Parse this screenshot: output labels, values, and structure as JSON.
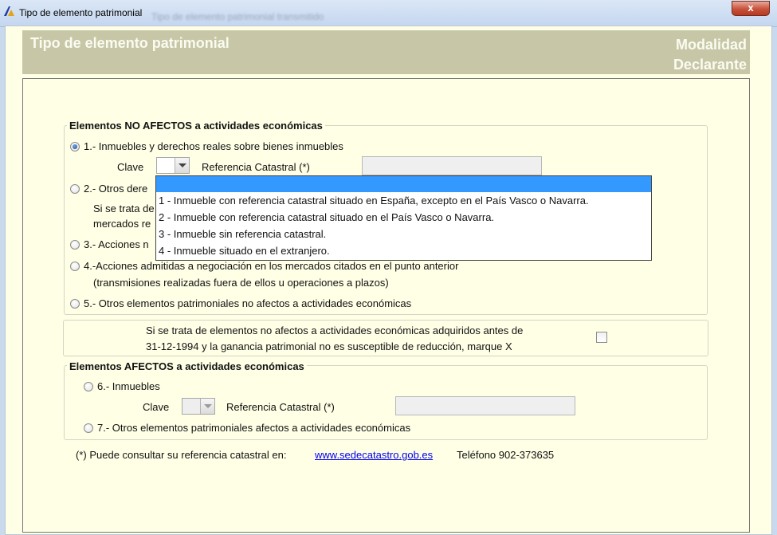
{
  "window": {
    "title": "Tipo de elemento patrimonial",
    "background_title": "Tipo de elemento patrimonial transmitido",
    "close_label": "x"
  },
  "header": {
    "title": "Tipo de elemento patrimonial",
    "right_line1": "Modalidad",
    "right_line2": "Declarante"
  },
  "no_afectos": {
    "title": "Elementos NO AFECTOS a actividades económicas",
    "opt1": "1.- Inmuebles y derechos reales sobre bienes inmuebles",
    "opt1_selected": true,
    "clave_label": "Clave",
    "referencia_label": "Referencia Catastral (*)",
    "opt2": "2.- Otros dere",
    "opt2_line1": "Si se trata de",
    "opt2_line2": "mercados re",
    "opt3": "3.- Acciones n",
    "opt4": "4.-Acciones admitidas a negociación en los mercados citados en el punto anterior",
    "opt4_sub": "(transmisiones realizadas fuera de ellos u operaciones a plazos)",
    "opt5": "5.- Otros elementos patrimoniales no afectos a actividades económicas"
  },
  "reduccion": {
    "line1": "Si se trata de elementos no afectos a actividades económicas adquiridos antes de",
    "line2": "31-12-1994 y la ganancia patrimonial no es susceptible de reducción, marque X",
    "checked": false
  },
  "afectos": {
    "title": "Elementos AFECTOS a actividades económicas",
    "opt6": "6.- Inmuebles",
    "clave_label": "Clave",
    "referencia_label": "Referencia Catastral (*)",
    "opt7": "7.- Otros elementos patrimoniales afectos a actividades económicas"
  },
  "footer": {
    "note": "(*) Puede consultar su referencia catastral en:",
    "link": "www.sedecatastro.gob.es",
    "telefono": "Teléfono 902-373635"
  },
  "clave_dropdown": {
    "selected": "",
    "options": [
      "1 - Inmueble con referencia catastral situado en España, excepto en el País Vasco o Navarra.",
      "2 - Inmueble con referencia catastral situado en el País Vasco o Navarra.",
      "3 - Inmueble sin referencia catastral.",
      "4 - Inmueble situado en el extranjero."
    ]
  },
  "colors": {
    "panel_bg": "#ffffe6",
    "header_band": "#c7c7a8",
    "selection": "#3399ff",
    "link": "#0000ee"
  }
}
